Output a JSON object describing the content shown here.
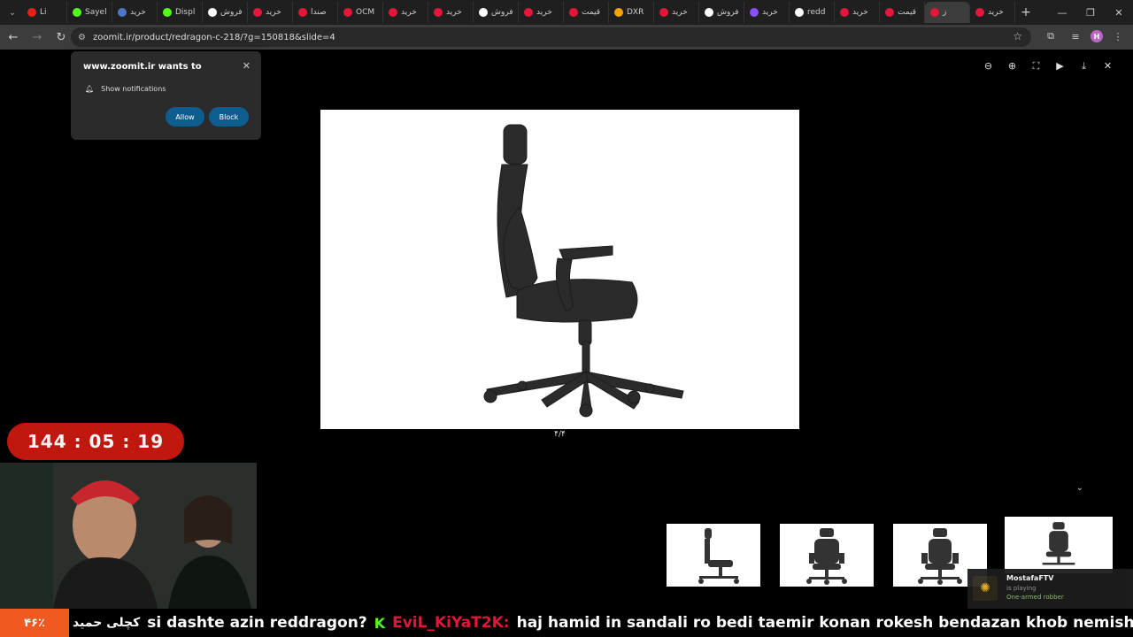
{
  "browser": {
    "tabs": [
      {
        "label": "Li",
        "color": "#e62117"
      },
      {
        "label": "Sayel",
        "color": "#53fc18"
      },
      {
        "label": "خرید",
        "color": "#4a78c6"
      },
      {
        "label": "Displ",
        "color": "#53fc18"
      },
      {
        "label": "فروش",
        "color": "#ffffff"
      },
      {
        "label": "خرید",
        "color": "#e4163a"
      },
      {
        "label": "صندا",
        "color": "#e4163a"
      },
      {
        "label": "OCM",
        "color": "#e4163a"
      },
      {
        "label": "خرید",
        "color": "#e4163a"
      },
      {
        "label": "خرید",
        "color": "#e4163a"
      },
      {
        "label": "فروش",
        "color": "#ffffff"
      },
      {
        "label": "خرید",
        "color": "#e4163a"
      },
      {
        "label": "قیمت",
        "color": "#e4163a"
      },
      {
        "label": "DXR",
        "color": "#f4a300"
      },
      {
        "label": "خرید",
        "color": "#e4163a"
      },
      {
        "label": "فروش",
        "color": "#ffffff"
      },
      {
        "label": "خرید",
        "color": "#8a4fff"
      },
      {
        "label": "redd",
        "color": "#ffffff"
      },
      {
        "label": "خرید",
        "color": "#e4163a"
      },
      {
        "label": "قیمت",
        "color": "#e4163a"
      },
      {
        "label": "ز",
        "color": "#e4163a"
      },
      {
        "label": "خرید",
        "color": "#e4163a"
      }
    ],
    "url": "zoomit.ir/product/redragon-c-218/?g=150818&slide=4"
  },
  "notification_prompt": {
    "title": "www.zoomit.ir wants to",
    "row": "Show notifications",
    "allow": "Allow",
    "block": "Block"
  },
  "viewer": {
    "counter": "۴/۴",
    "icons": [
      "zoom-out-icon",
      "zoom-in-icon",
      "fullscreen-icon",
      "play-icon",
      "download-icon",
      "close-icon"
    ]
  },
  "stream": {
    "timer": "144 : 05 : 19",
    "percent": "۴۶٪",
    "ticker_name": "کچلی حمید",
    "ticker_msg1": "si dashte azin reddragon?",
    "ticker_user": "EviL_KiYaT2K:",
    "ticker_msg2": "haj hamid in sandali ro bedi taemir konan rokesh bendazan khob nemishe",
    "accent": "#53fc18"
  },
  "notification": {
    "name": "MostafaFTV",
    "sub": "is playing",
    "game": "One-armed robber"
  }
}
